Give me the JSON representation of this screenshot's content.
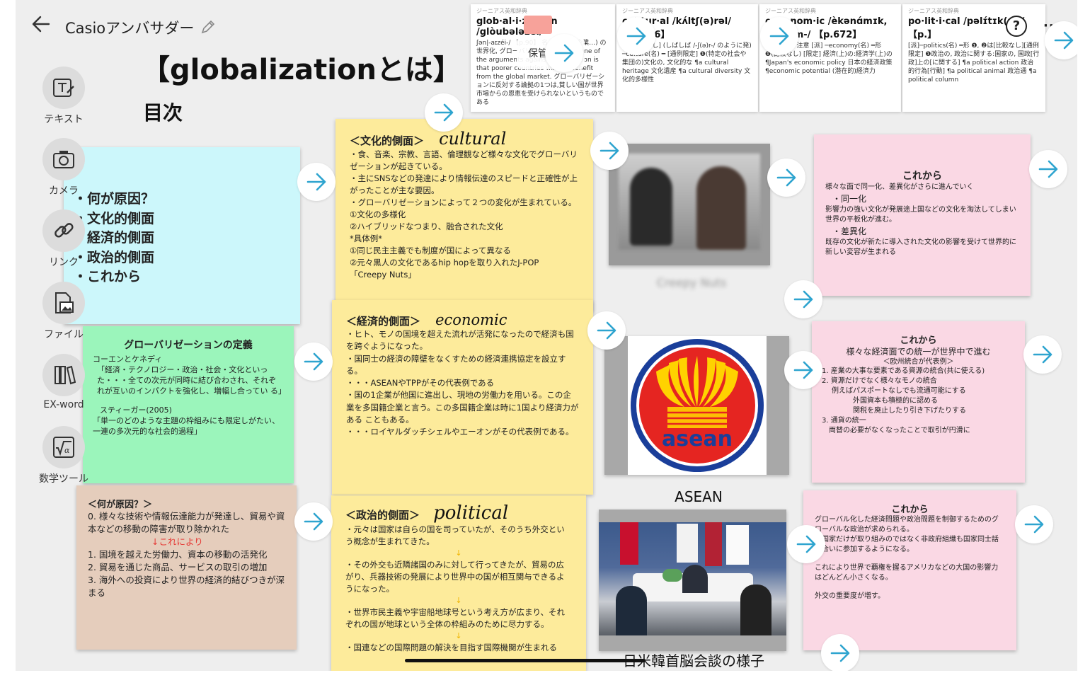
{
  "header": {
    "back_icon": "arrow-left-icon",
    "title": "Casioアンバサダー",
    "edit_icon": "pencil-icon"
  },
  "page": {
    "main_title": "【globalizationとは】",
    "toc_heading": "目次"
  },
  "toolbar": {
    "items": [
      {
        "label": "テキスト",
        "icon": "text-edit-icon"
      },
      {
        "label": "カメラ",
        "icon": "camera-icon"
      },
      {
        "label": "リンク",
        "icon": "link-icon"
      },
      {
        "label": "ファイル",
        "icon": "file-image-icon"
      },
      {
        "label": "EX-word",
        "icon": "dictionary-icon"
      },
      {
        "label": "数学ツール",
        "icon": "math-sqrt-icon"
      }
    ]
  },
  "toc_card": {
    "items": [
      "・何が原因？",
      "・文化的側面",
      "・経済的側面",
      "・政治的側面",
      "・これから"
    ]
  },
  "definition_card": {
    "title": "グローバリゼーションの定義",
    "line1": "コーエンとケネディ",
    "quote1": "「経済・テクノロジー・政治・社会・文化といった・・・全ての次元が同時に結び合わされ、それぞれが互いのインパクトを強化し、増幅し合ってい る」",
    "line2": "スティーガー(2005)",
    "quote2": "「単一のどのような主題の枠組みにも限定しがたい、一連の多次元的な社会的過程」"
  },
  "cause_card": {
    "title": "＜何が原因？＞",
    "line0": "0. 様々な技術や情報伝達能力が発達し、貿易や資本などの移動の障害が取り除かれた",
    "red_note": "↓これにより",
    "items": [
      "1. 国境を越えた労働力、資本の移動の活発化",
      "2. 貿易を通じた商品、サービスの取引の増加",
      "3. 海外への投資により世界の経済的結びつきが深まる"
    ]
  },
  "cultural_card": {
    "title": "＜文化的側面＞",
    "handwriting": "cultural",
    "lines": [
      "・食、音楽、宗教、言語、倫理観など様々な文化でグローバリゼーションが起きている。",
      "・主にSNSなどの発達により情報伝達のスピードと正確性が上がったことが主な要因。",
      "・グローバリゼーションによって２つの変化が生まれている。",
      "①文化の多様化",
      "②ハイブリッドなつまり、融合された文化",
      "*具体例*",
      "①同じ民主主義でも制度が国によって異なる",
      "②元々黒人の文化であるhip hopを取り入れたJ-POP",
      "「Creepy Nuts」"
    ]
  },
  "economic_card": {
    "title": "＜経済的側面＞",
    "handwriting": "economic",
    "lines": [
      "・ヒト、モノの国境を超えた流れが活発になったので経済も国を跨ぐようになった。",
      "・国同士の経済の障壁をなくすための経済連携協定を設立する。",
      "・・・ASEANやTPPがその代表例である",
      "・国の1企業が他国に進出し、現地の労働力を用いる。この企業を多国籍企業と言う。この多国籍企業は時に1国より経済力がある こともある。",
      "・・・ロイヤルダッチシェルやエーオンがその代表例である。"
    ]
  },
  "political_card": {
    "title": "＜政治的側面＞",
    "handwriting": "political",
    "lines": [
      "・元々は国家は自らの国を司っていたが、そのうち外交という概念が生まれてきた。",
      "・その外交も近隣諸国のみに対して行ってきたが、貿易の広がり、兵器技術の発展により世界中の国が相互関与できるようになった。",
      "・世界市民主義や宇宙船地球号という考え方が広まり、それぞれの国が地球という全体の枠組みのために尽力する。",
      "・国連などの国際問題の解決を目指す国際機関が生まれる"
    ]
  },
  "future_cards": [
    {
      "title": "これから",
      "lines": [
        "様々な面で同一化、差異化がさらに進んでいく",
        "・同一化",
        "影響力の強い文化が発展途上国などの文化を淘汰してしまい世界の平板化が進む。",
        "・差異化",
        "既存の文化が新たに導入された文化の影響を受けて世界的に新しい変容が生まれる"
      ]
    },
    {
      "title": "これから",
      "subtitle": "様々な経済面での統一が世界中で進む",
      "lines": [
        "＜欧州統合が代表例＞",
        "1. 産業の大事な要素である資源の統合(共に使える)",
        "2. 資源だけでなく様々なモノの統合",
        "例えばパスポートなしでも流通可能にする",
        "外国資本も積極的に認める",
        "関税を廃止したり引き下げたりする",
        "3. 通貨の統一",
        "両替の必要がなくなったことで取引が円滑に"
      ]
    },
    {
      "title": "これから",
      "lines": [
        "グローバル化した経済問題や政治問題を制御するためのグローバルな政治が求められる。",
        "権国家だけが取り組みのではなく非政府組織も国家同士話し合いに参加するようになる。",
        "これにより世界で覇権を握るアメリカなどの大国の影響力はどんどん小さくなる。",
        "外交の重要度が増す。"
      ]
    }
  ],
  "images": {
    "photo_caption": "Creepy Nuts",
    "asean_logo_text": "asean",
    "asean_caption": "ASEAN",
    "summit_caption": "日米韓首脳会談の様子"
  },
  "dictionary": {
    "source": "ジーニアス英和辞典",
    "entries": [
      {
        "head": "glob·al·i·za·tion /glòubələzéi/",
        "body": "ʃən|-aɪzéi-/ 【p.90】 名 U(市場・企業…) の世界化, グローバリゼーション 名 ●One of the arguments against globalization is that poorer countries will not benefit from the global market. グローバリゼーションに反対する論拠の1つは,貧しい国が世界市場からの恩恵を受けられないというものである"
      },
      {
        "head": "cul·tur·al /kʌ́ltʃ(ə)rəl/ 【p.516】",
        "body": "形 [比較なし] (しばしば /-ʃ(ə)r-/ のように発) ─culture(名) ━ [通例限定] ❶(特定の社会や集団の)文化の, 文化的な ¶a cultural heritage 文化遺産 ¶a cultural diversity 文化的多様性"
      },
      {
        "head": "ec·o·nom·ic /èkənɑ́mɪk, ìːk-|-ɔ́m-/ 【p.672】",
        "body": "アクセント注意 [派] ─economy(名) ━形 ❶(比較なし) [限定] 経済(上)の:経済学(上)の ¶Japan's economic policy 日本の経済政策 ¶economic potential (潜在的)経済力"
      },
      {
        "head": "po·lit·i·cal /pəlɪ́tɪk(ə)l/ 【p.】",
        "body": "[派]─politics(名) ━形 ❶, ❷は[比較なし][通例限定] ❶政治の, 政治に関する:国家の, 国政[行政]上の[に関する] ¶a political action 政治的行為[行動] ¶a political animal 政治通 ¶a political column"
      }
    ],
    "popup_label": "保管",
    "folder_icon": "folder-icon",
    "help_icon": "help-icon",
    "more_icon": "more-icon"
  },
  "colors": {
    "cyan": "#ccf7fb",
    "green": "#9bf5bb",
    "yellow": "#fdeb9b",
    "pink": "#fad8e4",
    "beige": "#e5cdbc",
    "arrow": "#2ea4cf",
    "red": "#e53935"
  }
}
